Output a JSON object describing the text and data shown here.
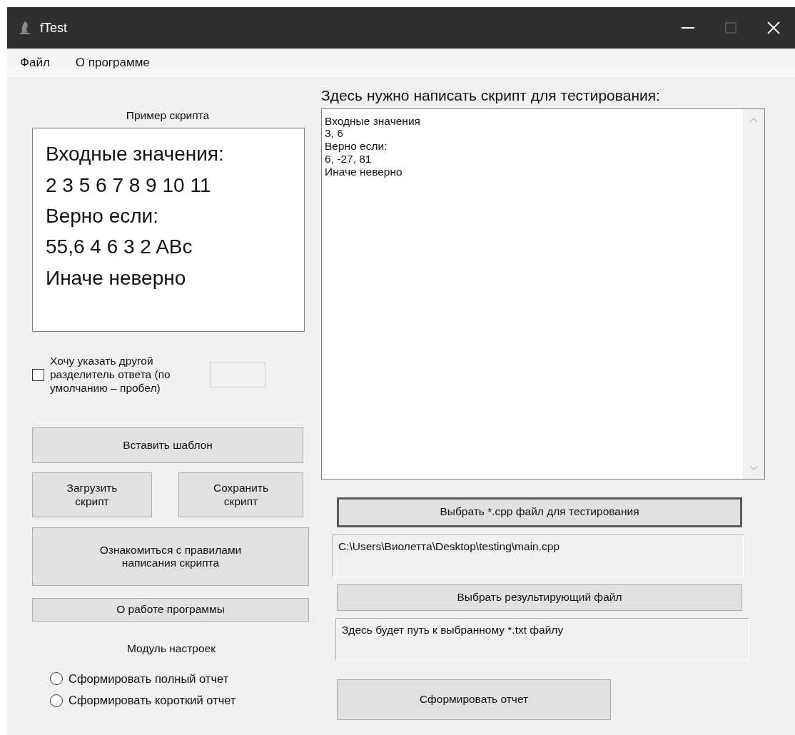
{
  "window": {
    "title": "fTest"
  },
  "menu": [
    "Файл",
    "О программе"
  ],
  "example": {
    "label": "Пример скрипта",
    "lines": [
      "Входные значения:",
      "2 3 5 6 7 8 9 10 11",
      "Верно если:",
      "55,6 4 6 3 2 ABc",
      "Иначе неверно"
    ]
  },
  "separator_option": {
    "label": "Хочу указать другой разделитель ответа (по умолчанию – пробел)",
    "checked": false
  },
  "template_button": "Вставить шаблон",
  "script_buttons": [
    "Загрузить скрипт",
    "Сохранить скрипт"
  ],
  "rules_button": "Ознакомиться с правилами написания скрипта",
  "about_button": "О работе программы",
  "settings": {
    "title": "Модуль настроек",
    "options": [
      {
        "label": "Сформировать полный отчет",
        "selected": false
      },
      {
        "label": "Сформировать короткий отчет",
        "selected": false
      }
    ]
  },
  "script": {
    "heading": "Здесь нужно написать скрипт для тестирования:",
    "lines": [
      "Входные значения",
      "3, 6",
      "Верно если:",
      "6, -27, 81",
      "Иначе неверно"
    ]
  },
  "cpp_button": "Выбрать *.cpp файл для тестирования",
  "cpp_path": "C:\\Users\\Виолетта\\Desktop\\testing\\main.cpp",
  "result_button": "Выбрать результирующий файл",
  "result_path": "Здесь будет путь к выбранному *.txt файлу",
  "report_button": "Сформировать отчет"
}
